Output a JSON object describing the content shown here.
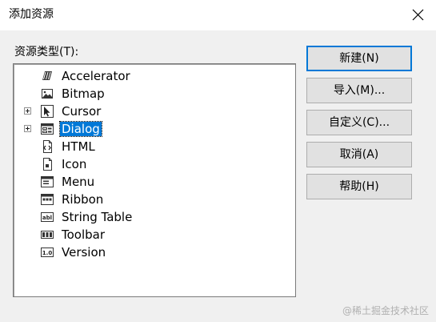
{
  "window": {
    "title": "添加资源",
    "close_icon": "close-icon"
  },
  "resource_type_label": "资源类型(T):",
  "tree": {
    "items": [
      {
        "label": "Accelerator",
        "icon": "accelerator-icon",
        "expandable": false,
        "selected": false
      },
      {
        "label": "Bitmap",
        "icon": "bitmap-icon",
        "expandable": false,
        "selected": false
      },
      {
        "label": "Cursor",
        "icon": "cursor-icon",
        "expandable": true,
        "selected": false
      },
      {
        "label": "Dialog",
        "icon": "dialog-icon",
        "expandable": true,
        "selected": true
      },
      {
        "label": "HTML",
        "icon": "html-icon",
        "expandable": false,
        "selected": false
      },
      {
        "label": "Icon",
        "icon": "icon-resource-icon",
        "expandable": false,
        "selected": false
      },
      {
        "label": "Menu",
        "icon": "menu-icon",
        "expandable": false,
        "selected": false
      },
      {
        "label": "Ribbon",
        "icon": "ribbon-icon",
        "expandable": false,
        "selected": false
      },
      {
        "label": "String Table",
        "icon": "string-table-icon",
        "expandable": false,
        "selected": false
      },
      {
        "label": "Toolbar",
        "icon": "toolbar-icon",
        "expandable": false,
        "selected": false
      },
      {
        "label": "Version",
        "icon": "version-icon",
        "expandable": false,
        "selected": false
      }
    ]
  },
  "buttons": {
    "new_label": "新建(N)",
    "import_label": "导入(M)...",
    "custom_label": "自定义(C)...",
    "cancel_label": "取消(A)",
    "help_label": "帮助(H)"
  },
  "colors": {
    "selection": "#0078d7",
    "default_button_border": "#0078d7"
  },
  "watermark": "@稀土掘金技术社区"
}
